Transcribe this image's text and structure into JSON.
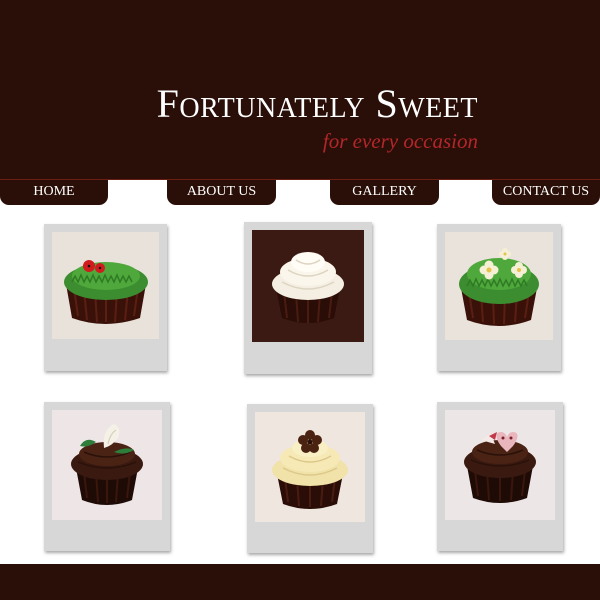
{
  "site": {
    "title": "Fortunately Sweet",
    "tagline": "for every occasion"
  },
  "nav": {
    "home": "HOME",
    "about": "ABOUT US",
    "gallery": "GALLERY",
    "contact": "CONTACT US"
  },
  "colors": {
    "brand_brown": "#2a0f08",
    "tagline_red": "#b3262a",
    "polaroid_frame": "#d7d7d7"
  },
  "gallery": {
    "items": [
      {
        "subject": "cupcake with green grass frosting and red ladybugs"
      },
      {
        "subject": "cupcake with white swirl frosting"
      },
      {
        "subject": "cupcake with green grass frosting and white flowers"
      },
      {
        "subject": "chocolate cupcake with white calla lily and leaves"
      },
      {
        "subject": "cupcake with cream swirl and brown flower"
      },
      {
        "subject": "chocolate cupcake with pink heart decoration"
      }
    ]
  }
}
